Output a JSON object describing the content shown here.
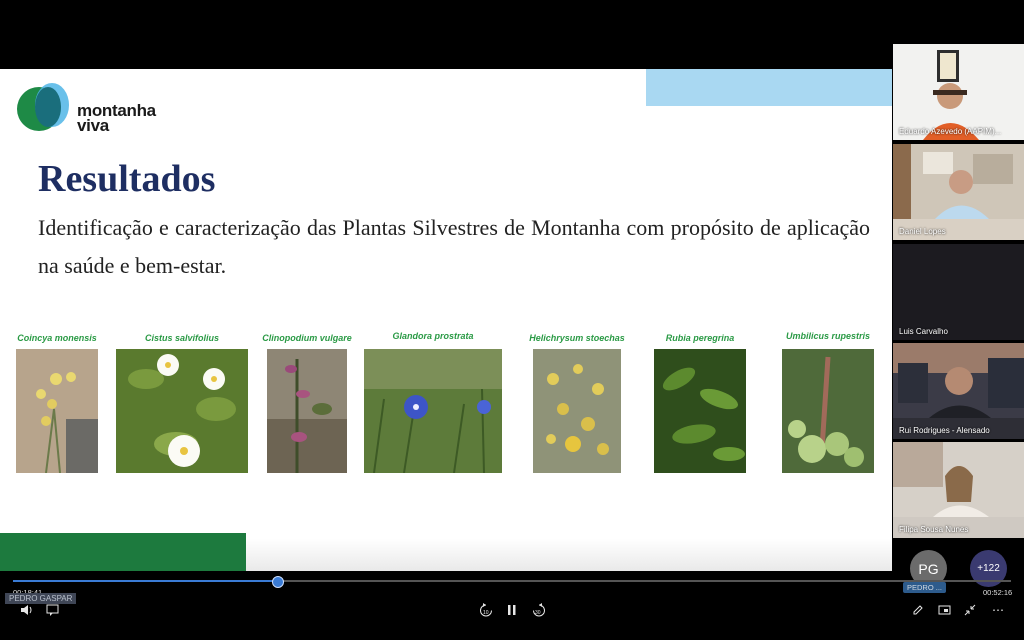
{
  "slide": {
    "brand": "montanha viva",
    "brand_line1": "montanha",
    "brand_line2": "viva",
    "title": "Resultados",
    "subtitle": "Identificação e caracterização das Plantas Silvestres de Montanha com propósito de aplicação na saúde e bem-estar.",
    "plants": [
      {
        "name": "Coincya monensis"
      },
      {
        "name": "Cistus salvifolius"
      },
      {
        "name": "Clinopodium vulgare"
      },
      {
        "name": "Glandora prostrata"
      },
      {
        "name": "Helichrysum stoechas"
      },
      {
        "name": "Rubia peregrina"
      },
      {
        "name": "Umbilicus rupestris"
      }
    ],
    "colors": {
      "title": "#1e2e62",
      "plant_label": "#2a9a45",
      "brand_green": "#1d7a3e",
      "accent_blue": "#a9d8f2"
    }
  },
  "participants": [
    {
      "name": "Eduardo Azevedo (AAPIM)..."
    },
    {
      "name": "Daniel Lopes"
    },
    {
      "name": "Luis Carvalho"
    },
    {
      "name": "Rui Rodrigues - Alensado"
    },
    {
      "name": "Filipa Sousa Nunes"
    }
  ],
  "presenter": {
    "initials": "PG",
    "label": "PEDRO ...",
    "tag": "PEDRO GASPAR"
  },
  "more_participants": "+122",
  "player": {
    "current_time": "00:18:41",
    "total_time": "00:52:16",
    "progress": 0.265,
    "rewind_label": "10",
    "forward_label": "30",
    "icons": [
      "volume-icon",
      "captions-icon",
      "rewind-10-icon",
      "pause-icon",
      "forward-30-icon",
      "pen-icon",
      "screen-icon",
      "exit-fullscreen-icon",
      "more-icon"
    ]
  }
}
